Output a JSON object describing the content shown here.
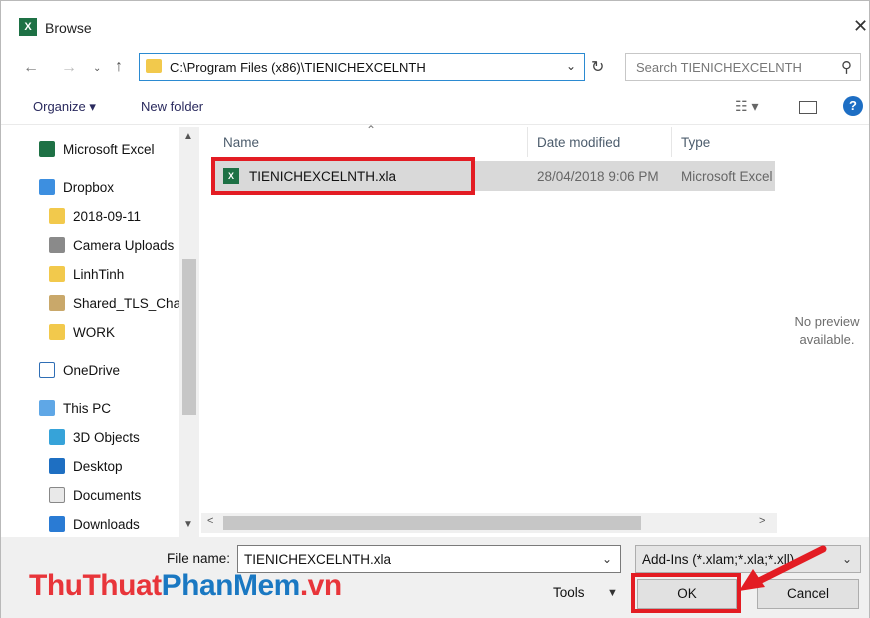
{
  "window": {
    "title": "Browse",
    "app_icon": "excel-icon"
  },
  "nav": {
    "address": "C:\\Program Files (x86)\\TIENICHEXCELNTH",
    "search_placeholder": "Search TIENICHEXCELNTH"
  },
  "toolbar": {
    "organize": "Organize ▾",
    "new_folder": "New folder"
  },
  "sidebar": {
    "items": [
      {
        "label": "Microsoft Excel",
        "icon": "excel-icon"
      },
      {
        "label": "Dropbox",
        "icon": "dropbox-icon"
      },
      {
        "label": "2018-09-11",
        "icon": "folder-icon"
      },
      {
        "label": "Camera Uploads",
        "icon": "camera-folder-icon"
      },
      {
        "label": "LinhTinh",
        "icon": "folder-icon"
      },
      {
        "label": "Shared_TLS_Cha",
        "icon": "shared-folder-icon"
      },
      {
        "label": "WORK",
        "icon": "folder-icon"
      },
      {
        "label": "OneDrive",
        "icon": "onedrive-icon"
      },
      {
        "label": "This PC",
        "icon": "pc-icon"
      },
      {
        "label": "3D Objects",
        "icon": "cube-icon"
      },
      {
        "label": "Desktop",
        "icon": "desktop-icon"
      },
      {
        "label": "Documents",
        "icon": "document-icon"
      },
      {
        "label": "Downloads",
        "icon": "download-icon"
      }
    ]
  },
  "columns": {
    "name": "Name",
    "date": "Date modified",
    "type": "Type"
  },
  "files": [
    {
      "name": "TIENICHEXCELNTH.xla",
      "date": "28/04/2018 9:06 PM",
      "type": "Microsoft Excel"
    }
  ],
  "preview": {
    "line1": "No preview",
    "line2": "available."
  },
  "footer": {
    "file_name_label": "File name:",
    "file_name_value": "TIENICHEXCELNTH.xla",
    "filter_value": "Add-Ins (*.xlam;*.xla;*.xll)",
    "tools_label": "Tools",
    "ok_label": "OK",
    "cancel_label": "Cancel"
  },
  "watermark": {
    "part1": "ThuThuat",
    "part2": "PhanMem",
    "part3": ".vn"
  },
  "colors": {
    "highlight_red": "#e31c23",
    "excel_green": "#1e7145",
    "accent_blue": "#2b8ad1"
  }
}
